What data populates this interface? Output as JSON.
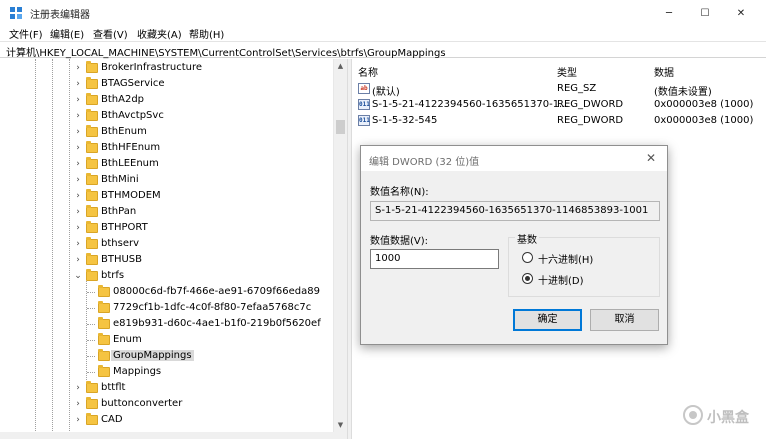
{
  "window": {
    "title": "注册表编辑器",
    "min_glyph": "─",
    "max_glyph": "☐",
    "close_glyph": "✕"
  },
  "menu": {
    "items": [
      {
        "label": "文件(F)"
      },
      {
        "label": "编辑(E)"
      },
      {
        "label": "查看(V)"
      },
      {
        "label": "收藏夹(A)"
      },
      {
        "label": "帮助(H)"
      }
    ]
  },
  "address": {
    "path": "计算机\\HKEY_LOCAL_MACHINE\\SYSTEM\\CurrentControlSet\\Services\\btrfs\\GroupMappings"
  },
  "tree": {
    "items": [
      {
        "label": "BrokerInfrastructure",
        "expander": "›"
      },
      {
        "label": "BTAGService",
        "expander": "›"
      },
      {
        "label": "BthA2dp",
        "expander": "›"
      },
      {
        "label": "BthAvctpSvc",
        "expander": "›"
      },
      {
        "label": "BthEnum",
        "expander": "›"
      },
      {
        "label": "BthHFEnum",
        "expander": "›"
      },
      {
        "label": "BthLEEnum",
        "expander": "›"
      },
      {
        "label": "BthMini",
        "expander": "›"
      },
      {
        "label": "BTHMODEM",
        "expander": "›"
      },
      {
        "label": "BthPan",
        "expander": "›"
      },
      {
        "label": "BTHPORT",
        "expander": "›"
      },
      {
        "label": "bthserv",
        "expander": "›"
      },
      {
        "label": "BTHUSB",
        "expander": "›"
      },
      {
        "label": "btrfs",
        "expander": "⌄"
      },
      {
        "label": "08000c6d-fb7f-466e-ae91-6709f66eda89",
        "expander": ""
      },
      {
        "label": "7729cf1b-1dfc-4c0f-8f80-7efaa5768c7c",
        "expander": ""
      },
      {
        "label": "e819b931-d60c-4ae1-b1f0-219b0f5620ef",
        "expander": ""
      },
      {
        "label": "Enum",
        "expander": ""
      },
      {
        "label": "GroupMappings",
        "expander": ""
      },
      {
        "label": "Mappings",
        "expander": ""
      },
      {
        "label": "bttflt",
        "expander": "›"
      },
      {
        "label": "buttonconverter",
        "expander": "›"
      },
      {
        "label": "CAD",
        "expander": "›"
      }
    ]
  },
  "list": {
    "headers": {
      "name": "名称",
      "type": "类型",
      "data": "数据"
    },
    "rows": [
      {
        "icon": "ab",
        "name": "(默认)",
        "type": "REG_SZ",
        "data": "(数值未设置)"
      },
      {
        "icon": "011",
        "name": "S-1-5-21-4122394560-1635651370-1...",
        "type": "REG_DWORD",
        "data": "0x000003e8 (1000)"
      },
      {
        "icon": "011",
        "name": "S-1-5-32-545",
        "type": "REG_DWORD",
        "data": "0x000003e8 (1000)"
      }
    ]
  },
  "dialog": {
    "title": "编辑 DWORD (32 位)值",
    "close_glyph": "✕",
    "name_label": "数值名称(N):",
    "name_value": "S-1-5-21-4122394560-1635651370-1146853893-1001",
    "data_label": "数值数据(V):",
    "data_value": "1000",
    "base_legend": "基数",
    "base_hex": "十六进制(H)",
    "base_dec": "十进制(D)",
    "base_selected": "decimal",
    "ok": "确定",
    "cancel": "取消"
  },
  "scroll": {
    "up": "▲",
    "down": "▼"
  },
  "watermark": {
    "text": "小黑盒"
  },
  "colors": {
    "accent": "#0078d7",
    "folder": "#f5c442",
    "selection": "#d9d9d9"
  }
}
